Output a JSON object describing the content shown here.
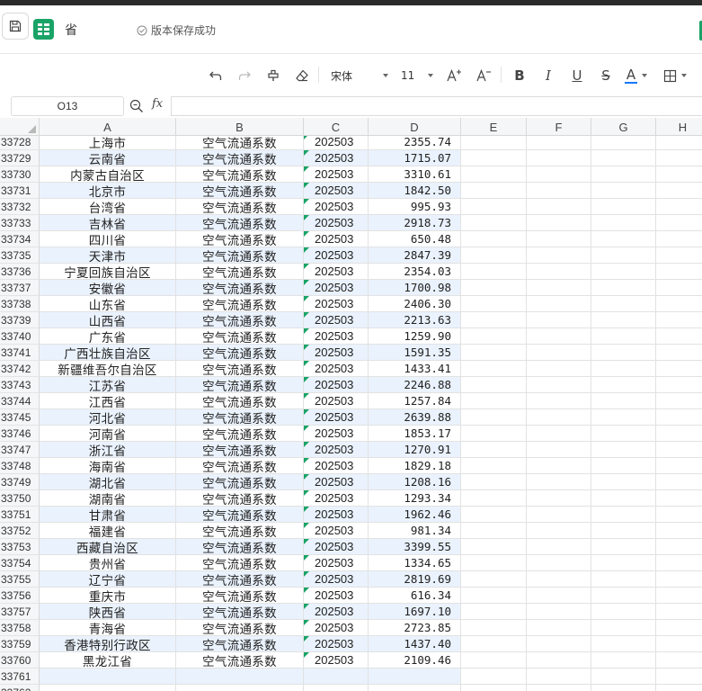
{
  "titlebar": {
    "doc_title": "省",
    "save_status": "版本保存成功"
  },
  "toolbar": {
    "font_name": "宋体",
    "font_size": "11",
    "bold": "B",
    "italic": "I",
    "underline": "U",
    "strike": "S",
    "font_color_label": "A",
    "font_color": "#1677ff"
  },
  "formula_bar": {
    "cell_ref": "O13",
    "fx_label": "fx",
    "formula": ""
  },
  "columns": [
    "A",
    "B",
    "C",
    "D",
    "E",
    "F",
    "G",
    "H"
  ],
  "rows": [
    {
      "num": "33728",
      "a": "上海市",
      "b": "空气流通系数",
      "c": "202503",
      "d": "2355.74"
    },
    {
      "num": "33729",
      "a": "云南省",
      "b": "空气流通系数",
      "c": "202503",
      "d": "1715.07"
    },
    {
      "num": "33730",
      "a": "内蒙古自治区",
      "b": "空气流通系数",
      "c": "202503",
      "d": "3310.61"
    },
    {
      "num": "33731",
      "a": "北京市",
      "b": "空气流通系数",
      "c": "202503",
      "d": "1842.50"
    },
    {
      "num": "33732",
      "a": "台湾省",
      "b": "空气流通系数",
      "c": "202503",
      "d": "995.93"
    },
    {
      "num": "33733",
      "a": "吉林省",
      "b": "空气流通系数",
      "c": "202503",
      "d": "2918.73"
    },
    {
      "num": "33734",
      "a": "四川省",
      "b": "空气流通系数",
      "c": "202503",
      "d": "650.48"
    },
    {
      "num": "33735",
      "a": "天津市",
      "b": "空气流通系数",
      "c": "202503",
      "d": "2847.39"
    },
    {
      "num": "33736",
      "a": "宁夏回族自治区",
      "b": "空气流通系数",
      "c": "202503",
      "d": "2354.03"
    },
    {
      "num": "33737",
      "a": "安徽省",
      "b": "空气流通系数",
      "c": "202503",
      "d": "1700.98"
    },
    {
      "num": "33738",
      "a": "山东省",
      "b": "空气流通系数",
      "c": "202503",
      "d": "2406.30"
    },
    {
      "num": "33739",
      "a": "山西省",
      "b": "空气流通系数",
      "c": "202503",
      "d": "2213.63"
    },
    {
      "num": "33740",
      "a": "广东省",
      "b": "空气流通系数",
      "c": "202503",
      "d": "1259.90"
    },
    {
      "num": "33741",
      "a": "广西壮族自治区",
      "b": "空气流通系数",
      "c": "202503",
      "d": "1591.35"
    },
    {
      "num": "33742",
      "a": "新疆维吾尔自治区",
      "b": "空气流通系数",
      "c": "202503",
      "d": "1433.41"
    },
    {
      "num": "33743",
      "a": "江苏省",
      "b": "空气流通系数",
      "c": "202503",
      "d": "2246.88"
    },
    {
      "num": "33744",
      "a": "江西省",
      "b": "空气流通系数",
      "c": "202503",
      "d": "1257.84"
    },
    {
      "num": "33745",
      "a": "河北省",
      "b": "空气流通系数",
      "c": "202503",
      "d": "2639.88"
    },
    {
      "num": "33746",
      "a": "河南省",
      "b": "空气流通系数",
      "c": "202503",
      "d": "1853.17"
    },
    {
      "num": "33747",
      "a": "浙江省",
      "b": "空气流通系数",
      "c": "202503",
      "d": "1270.91"
    },
    {
      "num": "33748",
      "a": "海南省",
      "b": "空气流通系数",
      "c": "202503",
      "d": "1829.18"
    },
    {
      "num": "33749",
      "a": "湖北省",
      "b": "空气流通系数",
      "c": "202503",
      "d": "1208.16"
    },
    {
      "num": "33750",
      "a": "湖南省",
      "b": "空气流通系数",
      "c": "202503",
      "d": "1293.34"
    },
    {
      "num": "33751",
      "a": "甘肃省",
      "b": "空气流通系数",
      "c": "202503",
      "d": "1962.46"
    },
    {
      "num": "33752",
      "a": "福建省",
      "b": "空气流通系数",
      "c": "202503",
      "d": "981.34"
    },
    {
      "num": "33753",
      "a": "西藏自治区",
      "b": "空气流通系数",
      "c": "202503",
      "d": "3399.55"
    },
    {
      "num": "33754",
      "a": "贵州省",
      "b": "空气流通系数",
      "c": "202503",
      "d": "1334.65"
    },
    {
      "num": "33755",
      "a": "辽宁省",
      "b": "空气流通系数",
      "c": "202503",
      "d": "2819.69"
    },
    {
      "num": "33756",
      "a": "重庆市",
      "b": "空气流通系数",
      "c": "202503",
      "d": "616.34"
    },
    {
      "num": "33757",
      "a": "陕西省",
      "b": "空气流通系数",
      "c": "202503",
      "d": "1697.10"
    },
    {
      "num": "33758",
      "a": "青海省",
      "b": "空气流通系数",
      "c": "202503",
      "d": "2723.85"
    },
    {
      "num": "33759",
      "a": "香港特别行政区",
      "b": "空气流通系数",
      "c": "202503",
      "d": "1437.40"
    },
    {
      "num": "33760",
      "a": "黑龙江省",
      "b": "空气流通系数",
      "c": "202503",
      "d": "2109.46"
    },
    {
      "num": "33761",
      "a": "",
      "b": "",
      "c": "",
      "d": ""
    },
    {
      "num": "33762",
      "a": "",
      "b": "",
      "c": "",
      "d": ""
    }
  ],
  "colors": {
    "accent": "#1aa367",
    "band": "#eaf2fd",
    "header_bg": "#f5f6f7"
  }
}
